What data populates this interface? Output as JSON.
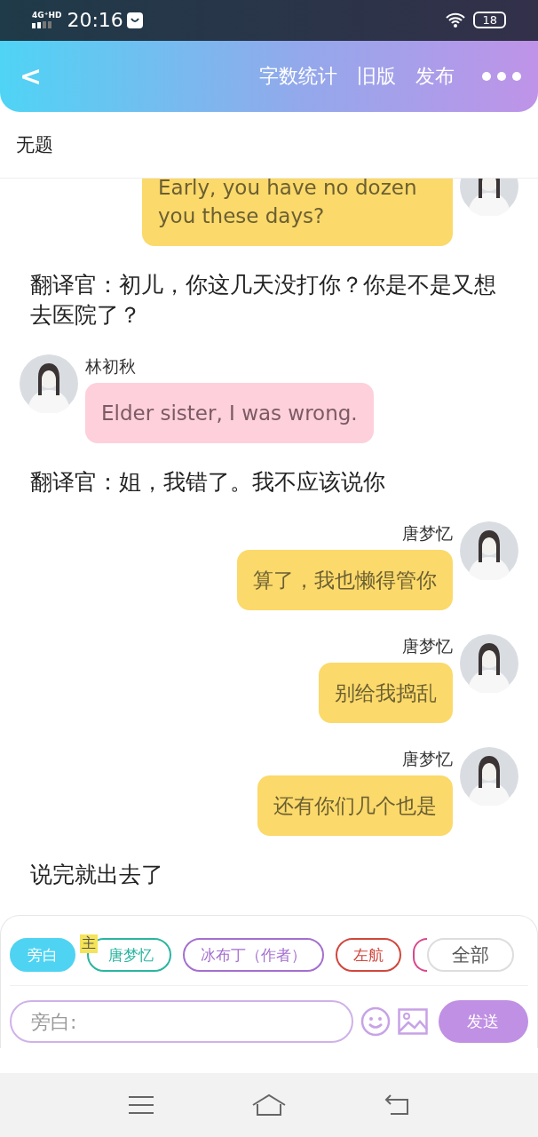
{
  "status_bar": {
    "network": "4G⁺HD",
    "time": "20:16",
    "battery": "18"
  },
  "header": {
    "back": "<",
    "actions": [
      "字数统计",
      "旧版",
      "发布"
    ]
  },
  "title": "无题",
  "messages": [
    {
      "kind": "right",
      "text": "Early, you have no dozen you these days?"
    },
    {
      "kind": "narration",
      "text": "翻译官：初儿，你这几天没打你？你是不是又想去医院了？"
    },
    {
      "kind": "left",
      "name": "林初秋",
      "text": "Elder sister, I was wrong."
    },
    {
      "kind": "narration",
      "text": "翻译官：姐，我错了。我不应该说你"
    },
    {
      "kind": "right",
      "name": "唐梦忆",
      "text": "算了，我也懒得管你"
    },
    {
      "kind": "right",
      "name": "唐梦忆",
      "text": "别给我捣乱"
    },
    {
      "kind": "right",
      "name": "唐梦忆",
      "text": "还有你们几个也是"
    },
    {
      "kind": "narration",
      "text": "说完就出去了"
    }
  ],
  "roles": [
    {
      "label": "旁白",
      "color": "#4fd3f2",
      "selected": true
    },
    {
      "label": "唐梦忆",
      "color": "#2bb5a0",
      "selected": false,
      "badge": "主"
    },
    {
      "label": "冰布丁（作者）",
      "color": "#a46fcf",
      "selected": false
    },
    {
      "label": "左航",
      "color": "#d0473c",
      "selected": false
    },
    {
      "color": "#d9478a",
      "selected": false
    }
  ],
  "all_button": "全部",
  "input": {
    "placeholder": "旁白:"
  },
  "send_button": "发送"
}
